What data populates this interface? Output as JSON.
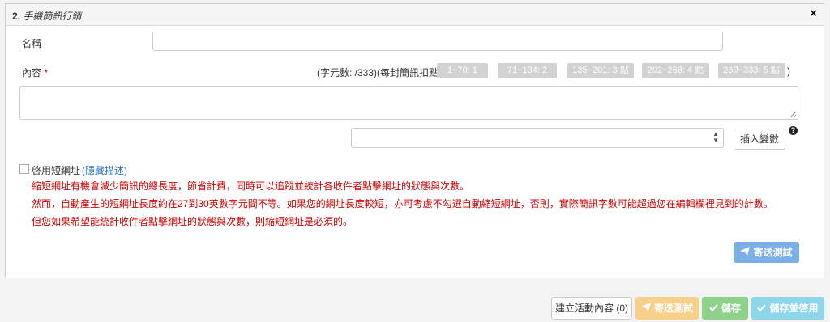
{
  "panel": {
    "number": "2.",
    "title": "手機簡訊行銷",
    "close": "×"
  },
  "form": {
    "name_label": "名稱",
    "content_label": "內容",
    "required_mark": "*",
    "char_info": "(字元數: /333)(每封簡訊扣點:",
    "paren_close": ")",
    "point_tiers": [
      "1~70: 1 點",
      "71~134: 2 點",
      "135~201: 3 點",
      "202~268: 4 點",
      "269~333: 5 點"
    ],
    "insert_button": "插入變數",
    "help": "?"
  },
  "short_url": {
    "label": "啓用短網址",
    "toggle_link": "(隱藏描述)",
    "desc_lines": [
      "縮短網址有機會減少簡訊的總長度，節省計費，同時可以追蹤並統計各收件者點擊網址的狀態與次數。",
      "然而，自動產生的短網址長度約在27到30英數字元間不等。如果您的網址長度較短，亦可考慮不勾選自動縮短網址，否則，實際簡訊字數可能超過您在編輯欄裡見到的計數。",
      "但您如果希望能統計收件者點擊網址的狀態與次數，則縮短網址是必須的。"
    ]
  },
  "panel_actions": {
    "send_test": "寄送測試"
  },
  "bottom_bar": {
    "create_content": "建立活動內容 (0)",
    "send_test": "寄送測試",
    "save": "儲存",
    "save_enable": "儲存並啓用"
  },
  "colors": {
    "required": "#cc0000",
    "link": "#2a6ebb",
    "send_test_primary": "#7bb0e6",
    "warning": "#f8d08a",
    "success": "#8ed18a",
    "info": "#8ed6ea"
  },
  "icons": {
    "send": "paper-plane-icon",
    "save": "check-icon",
    "close": "close-icon",
    "help": "question-circle-icon"
  }
}
